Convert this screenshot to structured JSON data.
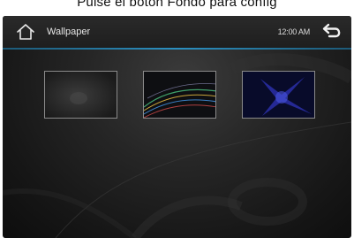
{
  "caption": {
    "text": "Pulse el botón Fondo  para config"
  },
  "header": {
    "title": "Wallpaper",
    "time": "12:00 AM"
  },
  "icons": {
    "home": "home-icon",
    "back": "back-arrow-icon"
  },
  "wallpapers": [
    {
      "name": "dark-gray-smoke"
    },
    {
      "name": "colored-streaks"
    },
    {
      "name": "blue-star-burst"
    }
  ],
  "colors": {
    "accent_line": "#2b8fc0",
    "thumb_border": "#8a8a8a"
  }
}
